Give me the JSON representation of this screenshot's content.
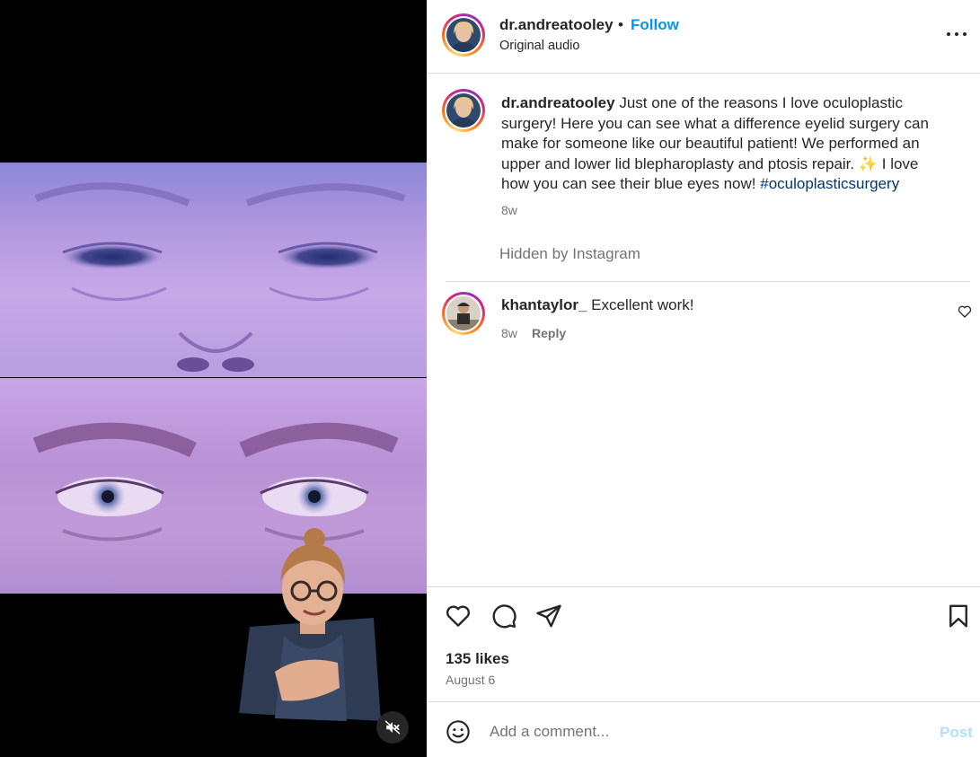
{
  "post": {
    "username": "dr.andreatooley",
    "dot": "•",
    "follow_label": "Follow",
    "audio": "Original audio",
    "more_icon": "more-horizontal-icon",
    "caption_text": " Just one of the reasons I love oculoplastic surgery! Here you can see what a difference eyelid surgery can make for someone like our beautiful patient! We performed an upper and lower lid blepharoplasty and ptosis repair. ✨ I love how you can see their blue eyes now! ",
    "caption_hashtag": "#oculoplasticsurgery",
    "caption_time": "8w",
    "hidden_note": "Hidden by Instagram",
    "likes": "135 likes",
    "date": "August 6"
  },
  "comments": [
    {
      "username": "khantaylor_",
      "text": " Excellent work!",
      "time": "8w",
      "reply_label": "Reply"
    }
  ],
  "composer": {
    "placeholder": "Add a comment...",
    "post_label": "Post"
  },
  "colors": {
    "accent": "#0095f6",
    "hashtag": "#00376b",
    "muted": "#737373",
    "post_disabled": "#b2dffc"
  },
  "icons": [
    "heart-icon",
    "comment-icon",
    "share-icon",
    "bookmark-icon",
    "emoji-icon",
    "muted-speaker-icon"
  ]
}
